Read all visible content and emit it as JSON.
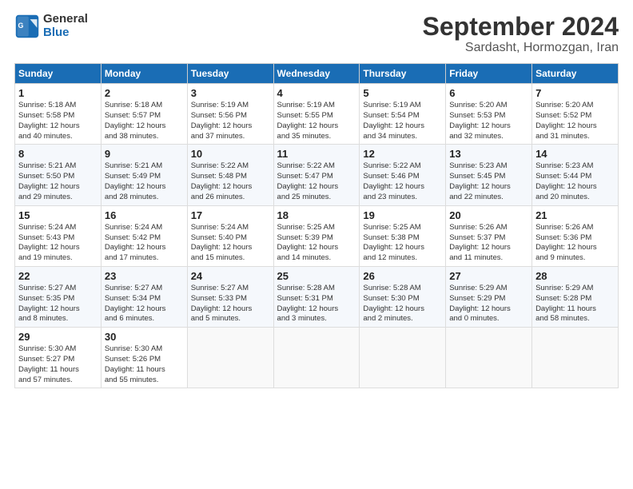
{
  "logo": {
    "general": "General",
    "blue": "Blue"
  },
  "title": "September 2024",
  "location": "Sardasht, Hormozgan, Iran",
  "headers": [
    "Sunday",
    "Monday",
    "Tuesday",
    "Wednesday",
    "Thursday",
    "Friday",
    "Saturday"
  ],
  "weeks": [
    [
      {
        "day": "1",
        "lines": [
          "Sunrise: 5:18 AM",
          "Sunset: 5:58 PM",
          "Daylight: 12 hours",
          "and 40 minutes."
        ]
      },
      {
        "day": "2",
        "lines": [
          "Sunrise: 5:18 AM",
          "Sunset: 5:57 PM",
          "Daylight: 12 hours",
          "and 38 minutes."
        ]
      },
      {
        "day": "3",
        "lines": [
          "Sunrise: 5:19 AM",
          "Sunset: 5:56 PM",
          "Daylight: 12 hours",
          "and 37 minutes."
        ]
      },
      {
        "day": "4",
        "lines": [
          "Sunrise: 5:19 AM",
          "Sunset: 5:55 PM",
          "Daylight: 12 hours",
          "and 35 minutes."
        ]
      },
      {
        "day": "5",
        "lines": [
          "Sunrise: 5:19 AM",
          "Sunset: 5:54 PM",
          "Daylight: 12 hours",
          "and 34 minutes."
        ]
      },
      {
        "day": "6",
        "lines": [
          "Sunrise: 5:20 AM",
          "Sunset: 5:53 PM",
          "Daylight: 12 hours",
          "and 32 minutes."
        ]
      },
      {
        "day": "7",
        "lines": [
          "Sunrise: 5:20 AM",
          "Sunset: 5:52 PM",
          "Daylight: 12 hours",
          "and 31 minutes."
        ]
      }
    ],
    [
      {
        "day": "8",
        "lines": [
          "Sunrise: 5:21 AM",
          "Sunset: 5:50 PM",
          "Daylight: 12 hours",
          "and 29 minutes."
        ]
      },
      {
        "day": "9",
        "lines": [
          "Sunrise: 5:21 AM",
          "Sunset: 5:49 PM",
          "Daylight: 12 hours",
          "and 28 minutes."
        ]
      },
      {
        "day": "10",
        "lines": [
          "Sunrise: 5:22 AM",
          "Sunset: 5:48 PM",
          "Daylight: 12 hours",
          "and 26 minutes."
        ]
      },
      {
        "day": "11",
        "lines": [
          "Sunrise: 5:22 AM",
          "Sunset: 5:47 PM",
          "Daylight: 12 hours",
          "and 25 minutes."
        ]
      },
      {
        "day": "12",
        "lines": [
          "Sunrise: 5:22 AM",
          "Sunset: 5:46 PM",
          "Daylight: 12 hours",
          "and 23 minutes."
        ]
      },
      {
        "day": "13",
        "lines": [
          "Sunrise: 5:23 AM",
          "Sunset: 5:45 PM",
          "Daylight: 12 hours",
          "and 22 minutes."
        ]
      },
      {
        "day": "14",
        "lines": [
          "Sunrise: 5:23 AM",
          "Sunset: 5:44 PM",
          "Daylight: 12 hours",
          "and 20 minutes."
        ]
      }
    ],
    [
      {
        "day": "15",
        "lines": [
          "Sunrise: 5:24 AM",
          "Sunset: 5:43 PM",
          "Daylight: 12 hours",
          "and 19 minutes."
        ]
      },
      {
        "day": "16",
        "lines": [
          "Sunrise: 5:24 AM",
          "Sunset: 5:42 PM",
          "Daylight: 12 hours",
          "and 17 minutes."
        ]
      },
      {
        "day": "17",
        "lines": [
          "Sunrise: 5:24 AM",
          "Sunset: 5:40 PM",
          "Daylight: 12 hours",
          "and 15 minutes."
        ]
      },
      {
        "day": "18",
        "lines": [
          "Sunrise: 5:25 AM",
          "Sunset: 5:39 PM",
          "Daylight: 12 hours",
          "and 14 minutes."
        ]
      },
      {
        "day": "19",
        "lines": [
          "Sunrise: 5:25 AM",
          "Sunset: 5:38 PM",
          "Daylight: 12 hours",
          "and 12 minutes."
        ]
      },
      {
        "day": "20",
        "lines": [
          "Sunrise: 5:26 AM",
          "Sunset: 5:37 PM",
          "Daylight: 12 hours",
          "and 11 minutes."
        ]
      },
      {
        "day": "21",
        "lines": [
          "Sunrise: 5:26 AM",
          "Sunset: 5:36 PM",
          "Daylight: 12 hours",
          "and 9 minutes."
        ]
      }
    ],
    [
      {
        "day": "22",
        "lines": [
          "Sunrise: 5:27 AM",
          "Sunset: 5:35 PM",
          "Daylight: 12 hours",
          "and 8 minutes."
        ]
      },
      {
        "day": "23",
        "lines": [
          "Sunrise: 5:27 AM",
          "Sunset: 5:34 PM",
          "Daylight: 12 hours",
          "and 6 minutes."
        ]
      },
      {
        "day": "24",
        "lines": [
          "Sunrise: 5:27 AM",
          "Sunset: 5:33 PM",
          "Daylight: 12 hours",
          "and 5 minutes."
        ]
      },
      {
        "day": "25",
        "lines": [
          "Sunrise: 5:28 AM",
          "Sunset: 5:31 PM",
          "Daylight: 12 hours",
          "and 3 minutes."
        ]
      },
      {
        "day": "26",
        "lines": [
          "Sunrise: 5:28 AM",
          "Sunset: 5:30 PM",
          "Daylight: 12 hours",
          "and 2 minutes."
        ]
      },
      {
        "day": "27",
        "lines": [
          "Sunrise: 5:29 AM",
          "Sunset: 5:29 PM",
          "Daylight: 12 hours",
          "and 0 minutes."
        ]
      },
      {
        "day": "28",
        "lines": [
          "Sunrise: 5:29 AM",
          "Sunset: 5:28 PM",
          "Daylight: 11 hours",
          "and 58 minutes."
        ]
      }
    ],
    [
      {
        "day": "29",
        "lines": [
          "Sunrise: 5:30 AM",
          "Sunset: 5:27 PM",
          "Daylight: 11 hours",
          "and 57 minutes."
        ]
      },
      {
        "day": "30",
        "lines": [
          "Sunrise: 5:30 AM",
          "Sunset: 5:26 PM",
          "Daylight: 11 hours",
          "and 55 minutes."
        ]
      },
      {
        "day": "",
        "lines": []
      },
      {
        "day": "",
        "lines": []
      },
      {
        "day": "",
        "lines": []
      },
      {
        "day": "",
        "lines": []
      },
      {
        "day": "",
        "lines": []
      }
    ]
  ]
}
